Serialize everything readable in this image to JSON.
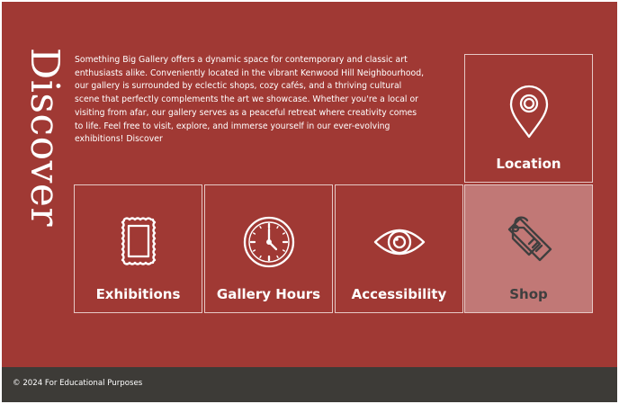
{
  "discover": {
    "heading": "Discover"
  },
  "intro": {
    "text": "Something Big Gallery offers a dynamic space for contemporary and classic art enthusiasts alike. Conveniently located in the vibrant Kenwood Hill Neighbourhood, our gallery is surrounded by eclectic shops, cozy cafés, and a thriving cultural scene that perfectly complements the art we showcase. Whether you're a local or visiting from afar, our gallery serves as a peaceful retreat where creativity comes to life. Feel free to visit, explore, and immerse yourself in our ever-evolving exhibitions! Discover"
  },
  "tiles": [
    {
      "label": "Location",
      "icon": "map-pin-icon",
      "active": false
    },
    {
      "label": "Exhibitions",
      "icon": "picture-frame-icon",
      "active": false
    },
    {
      "label": "Gallery Hours",
      "icon": "clock-icon",
      "active": false
    },
    {
      "label": "Accessibility",
      "icon": "eye-icon",
      "active": false
    },
    {
      "label": "Shop",
      "icon": "price-tag-icon",
      "active": true
    }
  ],
  "colors": {
    "background": "#a03934",
    "active_tile": "#c17876",
    "footer": "#3d3b37",
    "text": "#ffffff",
    "active_label": "#3f3f3f"
  },
  "footer": {
    "text": "© 2024 For Educational Purposes"
  }
}
